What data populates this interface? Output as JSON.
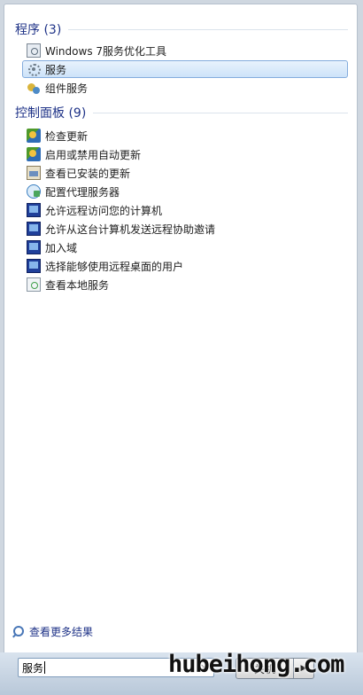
{
  "programs": {
    "header": "程序 (3)",
    "items": [
      {
        "label": "Windows 7服务优化工具",
        "icon": "program-icon"
      },
      {
        "label": "服务",
        "icon": "services-gear-icon",
        "selected": true
      },
      {
        "label": "组件服务",
        "icon": "component-services-icon"
      }
    ]
  },
  "control_panel": {
    "header": "控制面板 (9)",
    "items": [
      {
        "label": "检查更新",
        "icon": "windows-update-icon"
      },
      {
        "label": "启用或禁用自动更新",
        "icon": "windows-update-icon"
      },
      {
        "label": "查看已安装的更新",
        "icon": "installed-updates-icon"
      },
      {
        "label": "配置代理服务器",
        "icon": "proxy-server-icon"
      },
      {
        "label": "允许远程访问您的计算机",
        "icon": "remote-access-icon"
      },
      {
        "label": "允许从这台计算机发送远程协助邀请",
        "icon": "remote-access-icon"
      },
      {
        "label": "加入域",
        "icon": "remote-access-icon"
      },
      {
        "label": "选择能够使用远程桌面的用户",
        "icon": "remote-access-icon"
      },
      {
        "label": "查看本地服务",
        "icon": "local-services-icon"
      }
    ]
  },
  "more_results": "查看更多结果",
  "search": {
    "value": "服务",
    "clear": "×"
  },
  "shutdown": {
    "label": "关机",
    "arrow": "▶"
  },
  "watermark": "hubeihong.com",
  "colors": {
    "accent": "#1e3287",
    "selection": "#cde3f9"
  }
}
